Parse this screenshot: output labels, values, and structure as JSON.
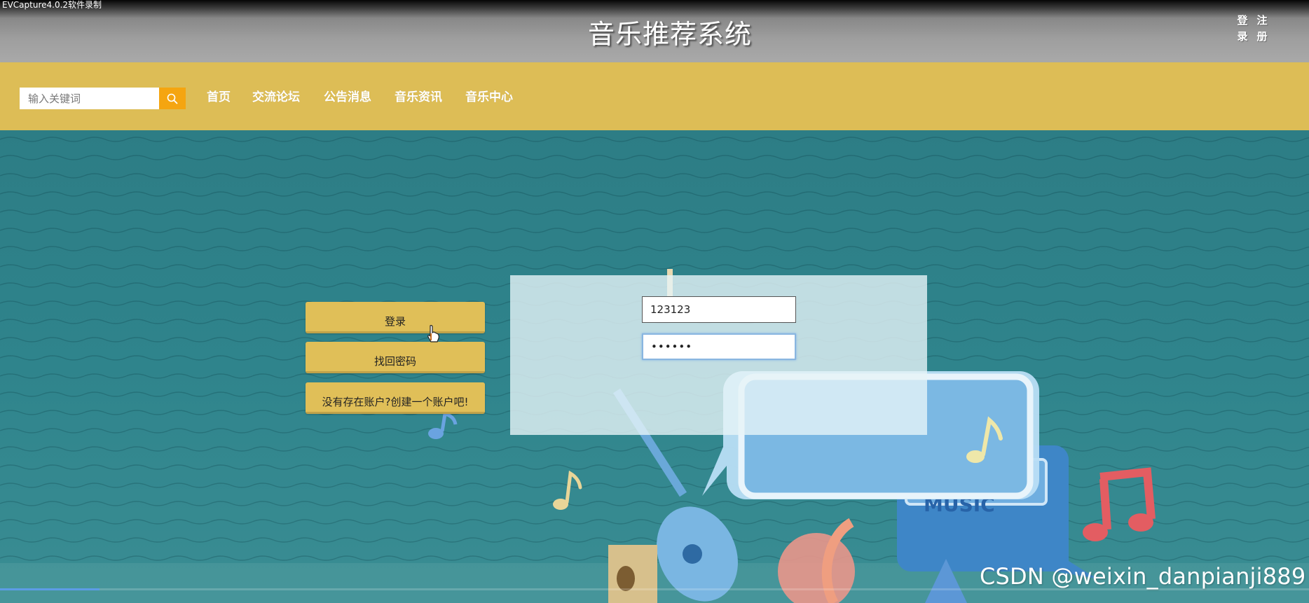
{
  "recorder": {
    "label": "EVCapture4.0.2软件录制"
  },
  "header": {
    "title": "音乐推荐系统",
    "login_chars": [
      "登",
      "录"
    ],
    "register_chars": [
      "注",
      "册"
    ]
  },
  "nav": {
    "search_placeholder": "输入关键词",
    "items": [
      "首页",
      "交流论坛",
      "公告消息",
      "音乐资讯",
      "音乐中心"
    ]
  },
  "side_buttons": {
    "login": "登录",
    "forgot_password": "找回密码",
    "create_account": "没有存在账户?创建一个账户吧!"
  },
  "login_form": {
    "username": "123123",
    "password": "123456"
  },
  "watermark": "CSDN @weixin_danpianji889",
  "illustration": {
    "speech_bubble_text": "MUSIC"
  },
  "progress": {
    "fraction": 0.076
  },
  "colors": {
    "navbar": "#ddbd56",
    "search_button": "#f5a510",
    "side_button": "#e0bf58",
    "background": "#2f7f87"
  }
}
